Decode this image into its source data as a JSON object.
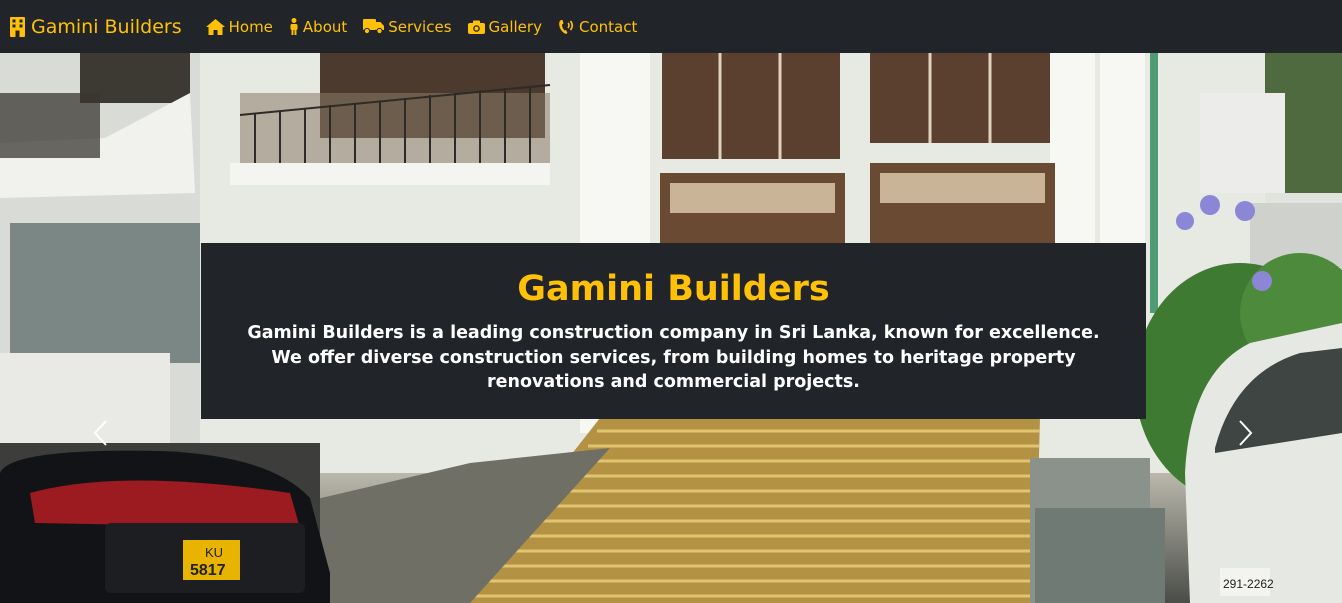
{
  "navbar": {
    "brand": "Gamini Builders",
    "links": [
      {
        "label": "Home",
        "icon": "home-icon"
      },
      {
        "label": "About",
        "icon": "person-icon"
      },
      {
        "label": "Services",
        "icon": "truck-icon"
      },
      {
        "label": "Gallery",
        "icon": "camera-icon"
      },
      {
        "label": "Contact",
        "icon": "phone-icon"
      }
    ]
  },
  "hero": {
    "title": "Gamini Builders",
    "description": "Gamini Builders is a leading construction company in Sri Lanka, known for excellence. We offer diverse construction services, from building homes to heritage property renovations and commercial projects.",
    "plate_left_top": "KU",
    "plate_left_bottom": "5817",
    "plate_right": "291-2262"
  },
  "colors": {
    "accent": "#ffc107",
    "dark": "#212529"
  }
}
